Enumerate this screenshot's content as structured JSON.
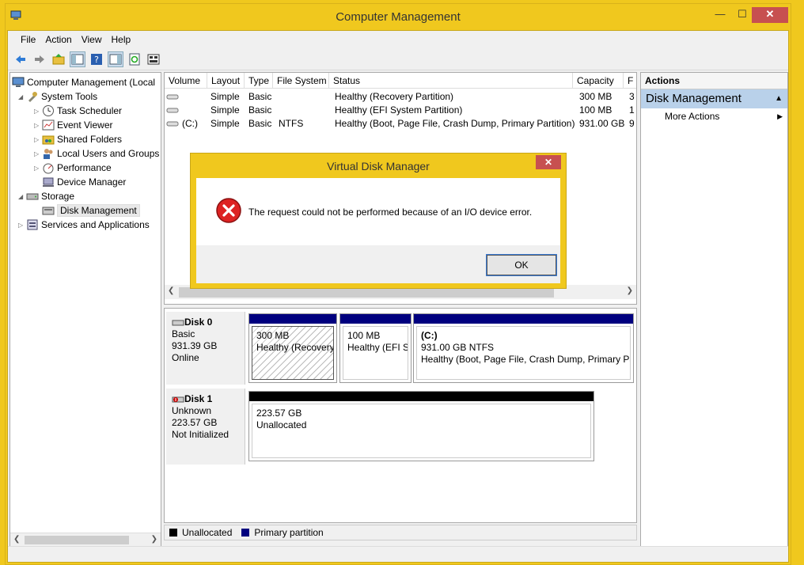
{
  "window": {
    "title": "Computer Management",
    "buttons": {
      "minimize": "—",
      "maximize": "☐",
      "close": "✕"
    }
  },
  "menu": [
    "File",
    "Action",
    "View",
    "Help"
  ],
  "toolbar": [
    "back-icon",
    "forward-icon",
    "up-folder-icon",
    "show-hide-tree-icon",
    "help-icon",
    "properties-icon",
    "refresh-icon",
    "rescan-disks-icon"
  ],
  "tree": {
    "root": "Computer Management (Local",
    "items": [
      {
        "label": "System Tools",
        "icon": "tools-icon"
      },
      {
        "label": "Task Scheduler",
        "icon": "clock-icon"
      },
      {
        "label": "Event Viewer",
        "icon": "event-viewer-icon"
      },
      {
        "label": "Shared Folders",
        "icon": "shared-folder-icon"
      },
      {
        "label": "Local Users and Groups",
        "icon": "users-icon"
      },
      {
        "label": "Performance",
        "icon": "performance-icon"
      },
      {
        "label": "Device Manager",
        "icon": "device-manager-icon"
      },
      {
        "label": "Storage",
        "icon": "storage-icon"
      },
      {
        "label": "Disk Management",
        "icon": "disk-management-icon"
      },
      {
        "label": "Services and Applications",
        "icon": "services-icon"
      }
    ]
  },
  "volumes": {
    "columns": [
      "Volume",
      "Layout",
      "Type",
      "File System",
      "Status",
      "Capacity",
      "F"
    ],
    "rows": [
      {
        "volume": "",
        "layout": "Simple",
        "type": "Basic",
        "fs": "",
        "status": "Healthy (Recovery Partition)",
        "capacity": "300 MB",
        "f": "3"
      },
      {
        "volume": "",
        "layout": "Simple",
        "type": "Basic",
        "fs": "",
        "status": "Healthy (EFI System Partition)",
        "capacity": "100 MB",
        "f": "1"
      },
      {
        "volume": "(C:)",
        "layout": "Simple",
        "type": "Basic",
        "fs": "NTFS",
        "status": "Healthy (Boot, Page File, Crash Dump, Primary Partition)",
        "capacity": "931.00 GB",
        "f": "9"
      }
    ]
  },
  "disks": [
    {
      "name": "Disk 0",
      "type": "Basic",
      "size": "931.39 GB",
      "state": "Online",
      "partitions": [
        {
          "line1": "300 MB",
          "line2": "Healthy (Recovery",
          "bar_color": "#00007f"
        },
        {
          "line1": "100 MB",
          "line2": "Healthy (EFI Sy",
          "bar_color": "#00007f"
        },
        {
          "line1": "(C:)",
          "line1b": "931.00 GB NTFS",
          "line2": "Healthy (Boot, Page File, Crash Dump, Primary Par",
          "bar_color": "#00007f"
        }
      ]
    },
    {
      "name": "Disk 1",
      "type": "Unknown",
      "size": "223.57 GB",
      "state": "Not Initialized",
      "partitions": [
        {
          "line1": "223.57 GB",
          "line2": "Unallocated",
          "bar_color": "#000000"
        }
      ]
    }
  ],
  "legend": [
    {
      "label": "Unallocated",
      "color": "#000000"
    },
    {
      "label": "Primary partition",
      "color": "#00007f"
    }
  ],
  "actions": {
    "header": "Actions",
    "section": "Disk Management",
    "items": [
      "More Actions"
    ]
  },
  "dialog": {
    "title": "Virtual Disk Manager",
    "close": "✕",
    "message": "The request could not be performed because of an I/O device error.",
    "ok": "OK"
  }
}
